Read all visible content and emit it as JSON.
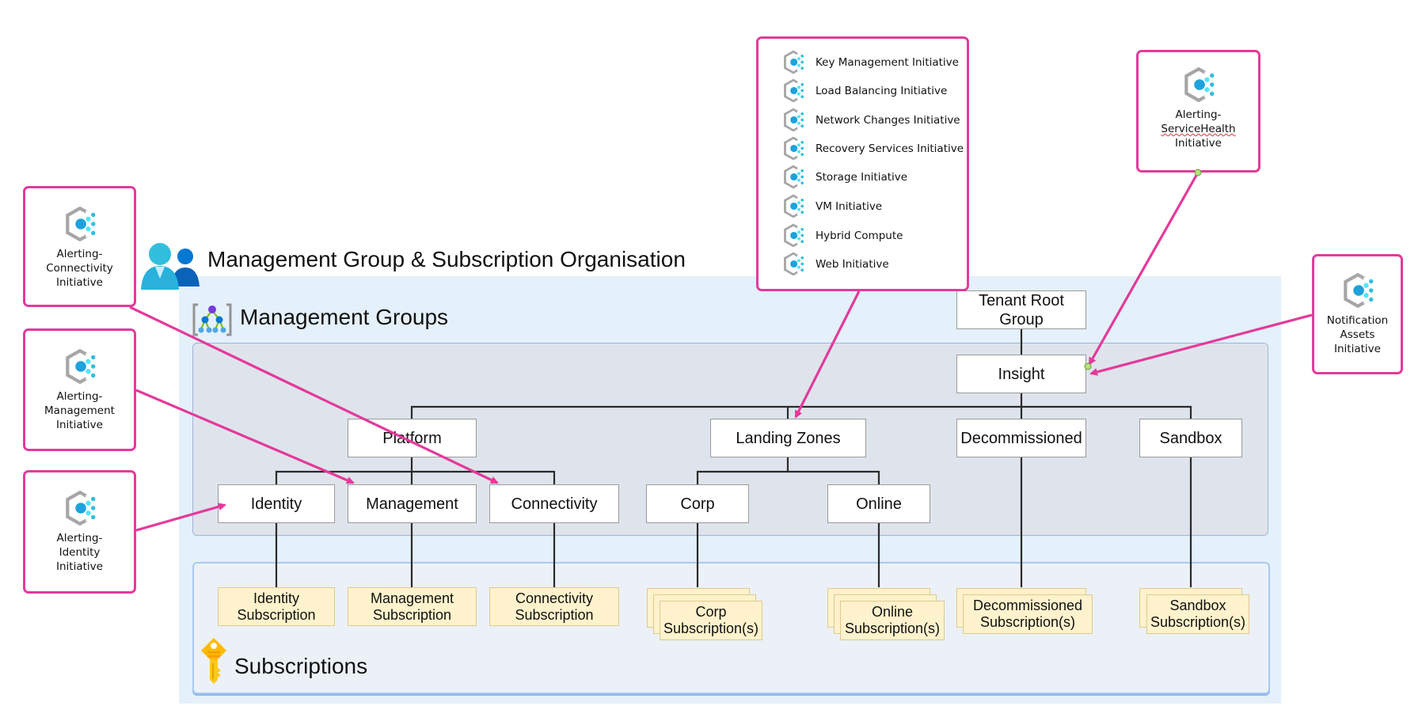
{
  "title": "Management Group & Subscription Organisation",
  "sections": {
    "management_groups": "Management Groups",
    "subscriptions": "Subscriptions"
  },
  "management_groups": {
    "tenant_root": "Tenant Root Group",
    "insight": "Insight",
    "platform": "Platform",
    "landing_zones": "Landing Zones",
    "decommissioned": "Decommissioned",
    "sandbox": "Sandbox",
    "identity": "Identity",
    "management": "Management",
    "connectivity": "Connectivity",
    "corp": "Corp",
    "online": "Online"
  },
  "subscriptions": {
    "identity": "Identity Subscription",
    "management": "Management Subscription",
    "connectivity": "Connectivity Subscription",
    "corp": "Corp Subscription(s)",
    "online": "Online Subscription(s)",
    "decommissioned": "Decommissioned Subscription(s)",
    "sandbox": "Sandbox Subscription(s)"
  },
  "callouts": {
    "alerting_connectivity": [
      "Alerting-",
      "Connectivity",
      "Initiative"
    ],
    "alerting_management": [
      "Alerting-",
      "Management",
      "Initiative"
    ],
    "alerting_identity": [
      "Alerting-",
      "Identity",
      "Initiative"
    ],
    "alerting_servicehealth": [
      "Alerting-",
      "ServiceHealth",
      "Initiative"
    ],
    "notification_assets": [
      "Notification",
      "Assets",
      "Initiative"
    ],
    "landing_zone_initiatives": [
      "Key Management Initiative",
      "Load Balancing Initiative",
      "Network Changes Initiative",
      "Recovery Services Initiative",
      "Storage Initiative",
      "VM Initiative",
      "Hybrid Compute",
      "Web Initiative"
    ]
  },
  "icons": {
    "people": "users-group-icon",
    "management_groups": "management-groups-icon",
    "subscriptions": "key-icon",
    "initiative": "policy-initiative-icon"
  },
  "colors": {
    "callout_border": "#e43a9b",
    "arrow": "#e43a9b",
    "subscription_fill": "#fff2cc",
    "mg_area": "#dfe4ec",
    "outer_area": "#e4f0fa"
  }
}
